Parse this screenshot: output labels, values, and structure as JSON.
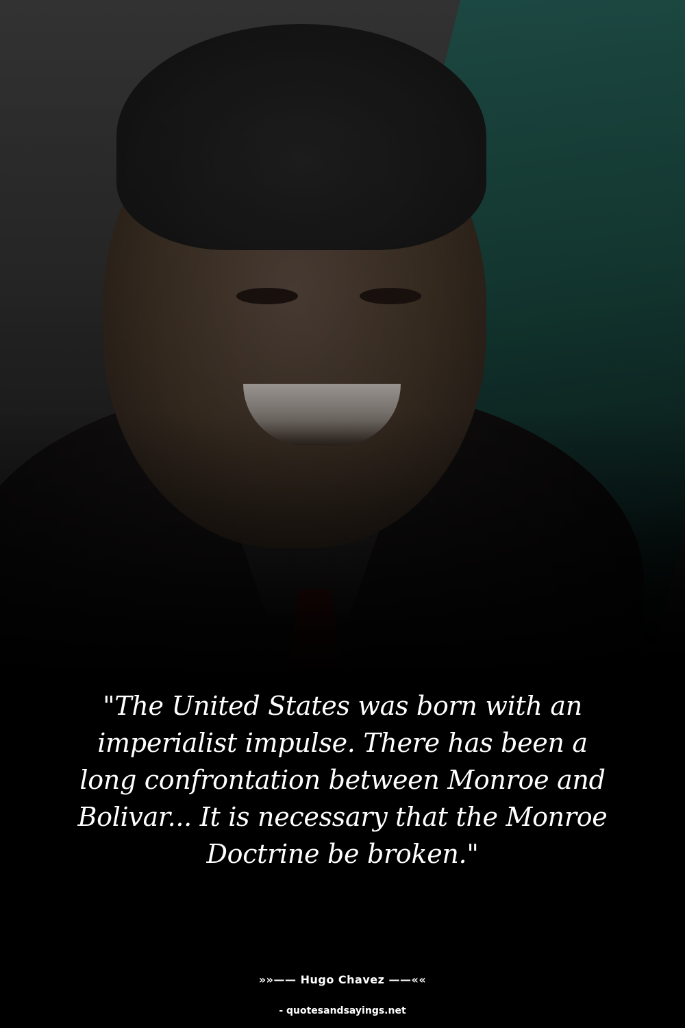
{
  "quote": {
    "text": "\"The United States was born with an imperialist impulse. There has been a long confrontation between Monroe and Bolivar... It is necessary that the Monroe Doctrine be broken.\""
  },
  "attribution": {
    "author_line": "»»—— Hugo Chavez ——««"
  },
  "footer": {
    "source": "- quotesandsayings.net"
  },
  "colors": {
    "background": "#000000",
    "text": "#ffffff",
    "flag_accent": "#1e5a52"
  }
}
